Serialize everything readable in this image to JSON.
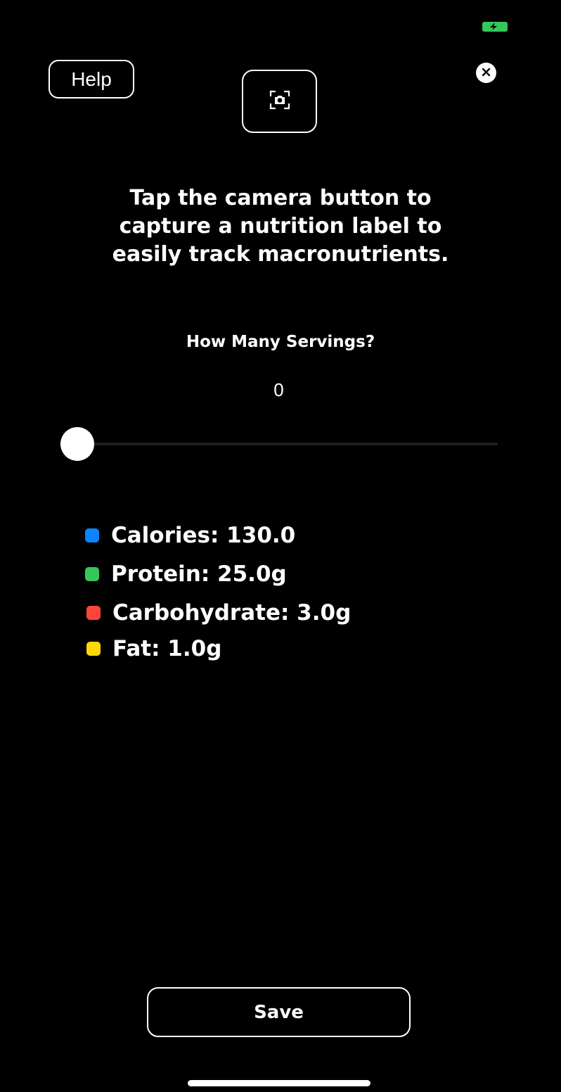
{
  "status_bar": {
    "battery_icon": "battery-charging-icon",
    "battery_color": "#34c759"
  },
  "toolbar": {
    "help_label": "Help",
    "camera_icon": "camera-viewfinder-icon",
    "close_icon": "close-circle-icon"
  },
  "instructions": "Tap the camera button to capture a nutrition label to easily track macronutrients.",
  "servings": {
    "label": "How Many Servings?",
    "value": "0",
    "slider_fraction": 0
  },
  "macros": [
    {
      "label": "Calories: 130.0",
      "color": "#0a84ff"
    },
    {
      "label": "Protein: 25.0g",
      "color": "#34c759"
    },
    {
      "label": "Carbohydrate: 3.0g",
      "color": "#ff453a"
    },
    {
      "label": "Fat: 1.0g",
      "color": "#ffd60a"
    }
  ],
  "save_label": "Save"
}
